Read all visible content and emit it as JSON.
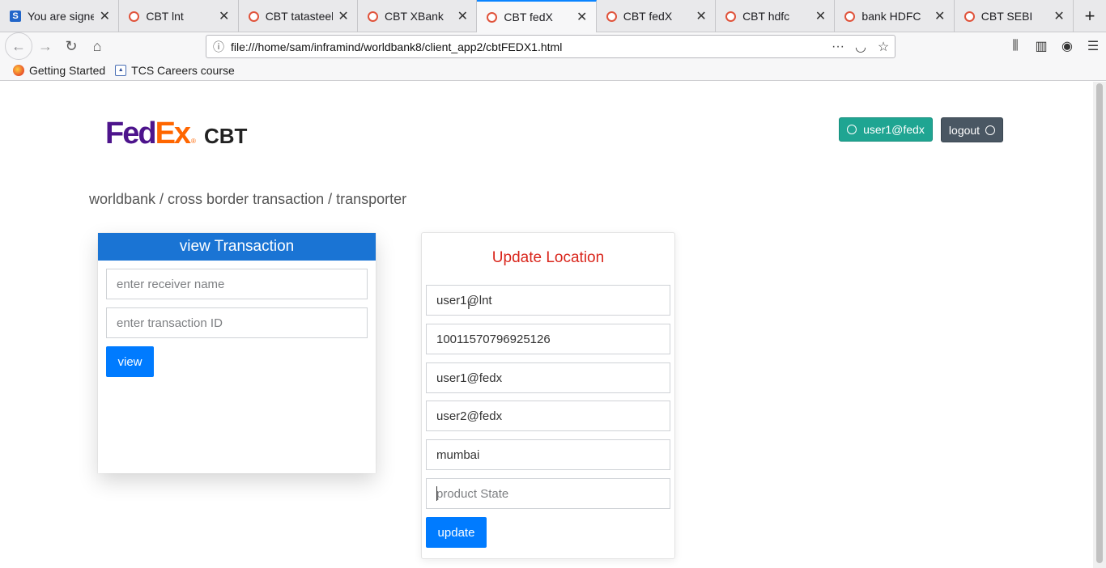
{
  "browser": {
    "tabs": [
      {
        "title": "You are signed",
        "icon": "s-favicon",
        "active": false
      },
      {
        "title": "CBT lnt",
        "icon": "red-ring-favicon",
        "active": false
      },
      {
        "title": "CBT tatasteel",
        "icon": "red-ring-favicon",
        "active": false
      },
      {
        "title": "CBT XBank",
        "icon": "red-ring-favicon",
        "active": false
      },
      {
        "title": "CBT fedX",
        "icon": "red-ring-favicon",
        "active": true
      },
      {
        "title": "CBT fedX",
        "icon": "red-ring-favicon",
        "active": false
      },
      {
        "title": "CBT hdfc",
        "icon": "red-ring-favicon",
        "active": false
      },
      {
        "title": "bank HDFC",
        "icon": "red-ring-favicon",
        "active": false
      },
      {
        "title": "CBT SEBI",
        "icon": "red-ring-favicon",
        "active": false
      }
    ],
    "url": "file:///home/sam/inframind/worldbank8/client_app2/cbtFEDX1.html",
    "bookmarks": [
      {
        "label": "Getting Started",
        "icon": "firefox-icon"
      },
      {
        "label": "TCS Careers course",
        "icon": "tcs-icon"
      }
    ]
  },
  "header": {
    "logo_fed": "Fed",
    "logo_ex": "Ex",
    "logo_reg": "®",
    "logo_suffix": "CBT",
    "user_label": "user1@fedx",
    "logout_label": "logout"
  },
  "breadcrumb": "worldbank / cross border transaction / transporter",
  "view_transaction": {
    "title": "view Transaction",
    "receiver_placeholder": "enter receiver name",
    "txn_placeholder": "enter transaction ID",
    "view_label": "view"
  },
  "update_location": {
    "title": "Update Location",
    "sender": "user1@lnt",
    "transaction_id": "10011570796925126",
    "from_user": "user1@fedx",
    "to_user": "user2@fedx",
    "location": "mumbai",
    "state_placeholder": "product State",
    "update_label": "update"
  },
  "colors": {
    "fedex_purple": "#4d148c",
    "fedex_orange": "#ff6600",
    "primary_blue": "#007bff",
    "user_teal": "#1fa592",
    "update_title_red": "#d9261c"
  }
}
